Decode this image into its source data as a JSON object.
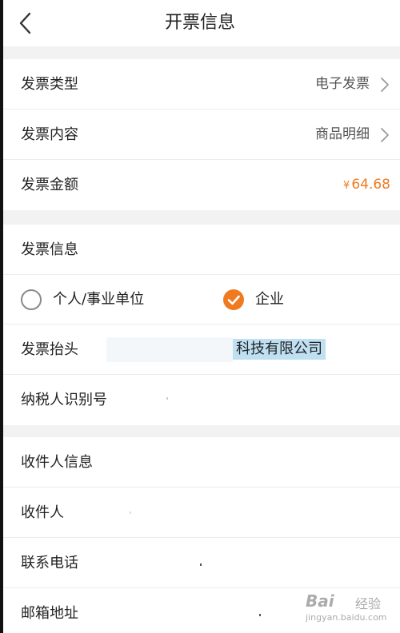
{
  "header": {
    "title": "开票信息"
  },
  "invoice_basic": {
    "type": {
      "label": "发票类型",
      "value": "电子发票"
    },
    "content": {
      "label": "发票内容",
      "value": "商品明细"
    },
    "amount": {
      "label": "发票金额",
      "currency": "¥",
      "value": "64.68"
    }
  },
  "invoice_info": {
    "heading": "发票信息",
    "options": [
      {
        "label": "个人/事业单位",
        "selected": false
      },
      {
        "label": "企业",
        "selected": true
      }
    ],
    "title_label": "发票抬头",
    "title_value": "科技有限公司",
    "tax_id_label": "纳税人识别号"
  },
  "recipient": {
    "heading": "收件人信息",
    "name_label": "收件人",
    "phone_label": "联系电话",
    "email_label": "邮箱地址"
  },
  "watermark": {
    "logo": "Bai",
    "logo_suffix": "经验",
    "url": "jingyan.baidu.com"
  },
  "colors": {
    "accent": "#f07a20",
    "background": "#f2f2f2"
  }
}
